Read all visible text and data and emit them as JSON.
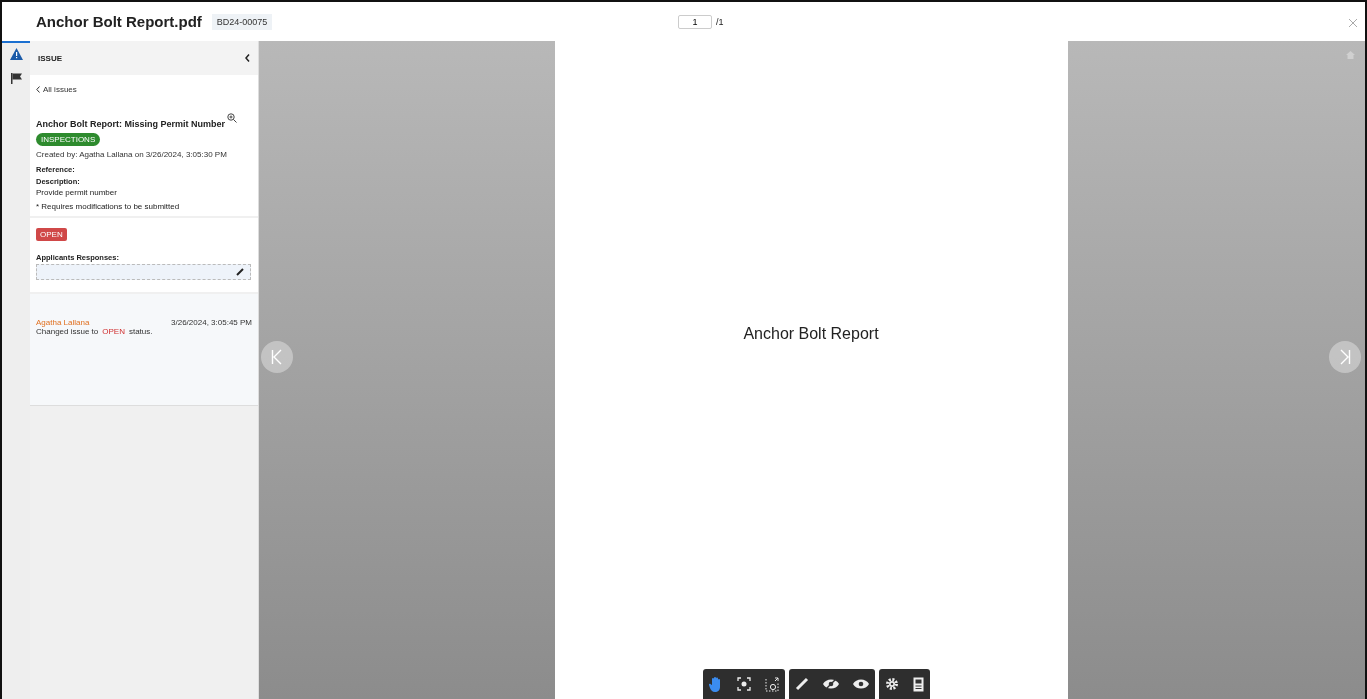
{
  "header": {
    "title": "Anchor Bolt Report.pdf",
    "document_id": "BD24-00075",
    "page_input": "1",
    "page_total": "/1"
  },
  "rail_tabs": [
    {
      "kind": "issue",
      "selected": true
    },
    {
      "kind": "flag",
      "selected": false
    }
  ],
  "sidebar": {
    "title": "ISSUE",
    "back_link": "All issues",
    "issue": {
      "title": "Anchor Bolt Report: Missing Permit Number",
      "tag": "INSPECTIONS",
      "created": "Created by: Agatha Lallana on 3/26/2024, 3:05:30 PM",
      "reference_label": "Reference:",
      "description_label": "Description:",
      "description": "Provide permit number",
      "note": "* Requires modifications to be submitted"
    },
    "status": "OPEN",
    "responses_label": "Applicants Responses:",
    "activity": [
      {
        "author": "Agatha Lallana",
        "time": "3/26/2024, 3:05:45 PM",
        "message_before": "Changed issue to",
        "status": "OPEN",
        "message_after": "status."
      }
    ]
  },
  "page": {
    "text": "Anchor Bolt Report"
  },
  "toolbar": [
    [
      {
        "kind": "hand",
        "selected": true
      },
      {
        "kind": "fit",
        "selected": false
      },
      {
        "kind": "zoom-area",
        "selected": false
      }
    ],
    [
      {
        "kind": "pen",
        "selected": false
      },
      {
        "kind": "hide",
        "selected": false
      },
      {
        "kind": "show",
        "selected": false
      }
    ],
    [
      {
        "kind": "settings",
        "selected": false
      },
      {
        "kind": "panel",
        "selected": false
      }
    ]
  ]
}
